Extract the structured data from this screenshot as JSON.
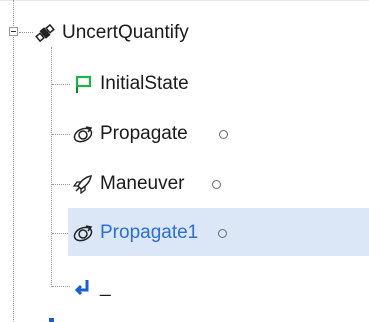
{
  "tree": {
    "root": {
      "label": "UncertQuantify",
      "icon": "satellite-icon"
    },
    "children": [
      {
        "label": "InitialState",
        "icon": "green-flag-icon",
        "has_radio": false,
        "selected": false
      },
      {
        "label": "Propagate",
        "icon": "propagate-orbit-icon",
        "has_radio": true,
        "selected": false
      },
      {
        "label": "Maneuver",
        "icon": "rocket-icon",
        "has_radio": true,
        "selected": false
      },
      {
        "label": "Propagate1",
        "icon": "propagate-orbit-icon",
        "has_radio": true,
        "selected": true
      },
      {
        "label": "_",
        "icon": "return-arrow-icon",
        "has_radio": false,
        "selected": false
      }
    ]
  },
  "colors": {
    "selection_bg": "#dbe7f7",
    "selection_text": "#2b6fd6",
    "flag_green": "#22b14c",
    "return_blue": "#1a5fd1"
  }
}
